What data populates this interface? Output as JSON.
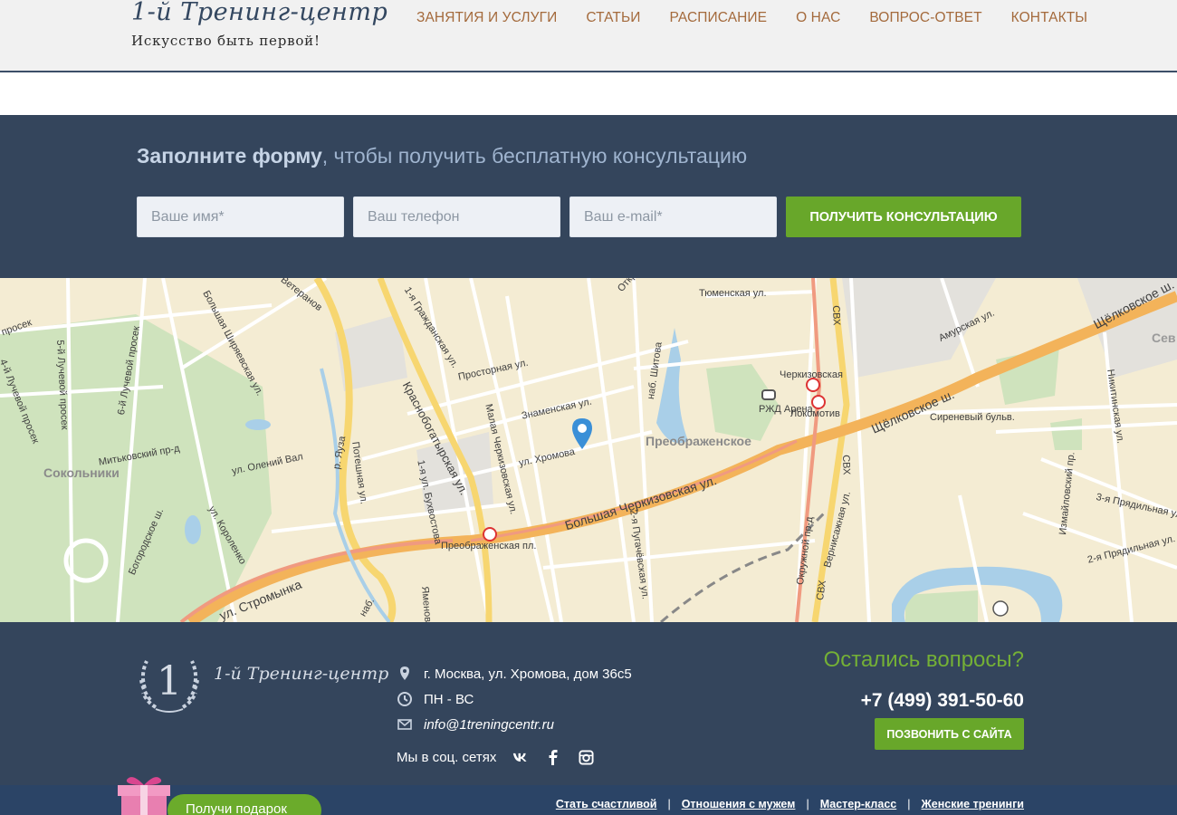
{
  "header": {
    "logo_title": "1-й Тренинг-центр",
    "logo_tagline": "Искусство быть первой!",
    "nav": [
      "ЗАНЯТИЯ И УСЛУГИ",
      "СТАТЬИ",
      "РАСПИСАНИЕ",
      "О НАС",
      "ВОПРОС-ОТВЕТ",
      "КОНТАКТЫ"
    ]
  },
  "form": {
    "heading_bold": "Заполните форму",
    "heading_rest": ", чтобы получить бесплатную консультацию",
    "name_placeholder": "Ваше имя*",
    "phone_placeholder": "Ваш телефон",
    "email_placeholder": "Ваш e-mail*",
    "submit_label": "ПОЛУЧИТЬ КОНСУЛЬТАЦИЮ",
    "accent_color": "#68a72a",
    "band_color": "#34455c"
  },
  "map": {
    "districts": [
      "Сокольники",
      "Преображенское",
      "Сев Изм"
    ],
    "streets": [
      "Тюменская ул.",
      "Амурская ул.",
      "Щёлковское ш.",
      "Черкизовская",
      "Локомотив",
      "РЖД Арена",
      "Сиреневый бульв.",
      "Просторная ул.",
      "Знаменская ул.",
      "ул. Хромова",
      "Большая Черкизовская ул.",
      "Преображенская пл.",
      "ул. Стромынка",
      "Краснобогатырская ул.",
      "Малая Черкизовская ул.",
      "наб. Шитова",
      "Окружной пр-д",
      "Вернисажная ул.",
      "Измайловский пр.",
      "3-я Прядильная ул.",
      "2-я Прядильная ул.",
      "Никитинская ул.",
      "2-я Пугачёвская ул.",
      "Потешная ул.",
      "1-я ул. Бухвостова",
      "ул. Олений Вал",
      "Богородское ш.",
      "ул. Короленко",
      "Митьковский пр-д",
      "6-й Лучевой просек",
      "5-й Лучевой просек",
      "4-й Лучевой просек",
      "Большая Ширяевская ул.",
      "1-я Гражданская ул.",
      "Ветеранов",
      "СВХ",
      "Открыт",
      "р. Яуза",
      "наб.",
      "просек",
      "Яменова"
    ]
  },
  "footer": {
    "brand": "1-й Тренинг-центр",
    "address": "г. Москва, ул. Хромова, дом 36с5",
    "hours": "ПН - ВС",
    "email": "info@1treningcentr.ru",
    "social_label": "Мы в соц. сетях",
    "questions": "Остались вопросы?",
    "phone": "+7 (499) 391-50-60",
    "callback_label": "ПОЗВОНИТЬ С САЙТА"
  },
  "bottom": {
    "gift_label": "Получи подарок",
    "links": [
      "Стать счастливой",
      "Отношения с мужем",
      "Мастер-класс",
      "Женские тренинги"
    ],
    "sep": "|"
  },
  "icons": {
    "pin": "location-pin-icon",
    "clock": "clock-icon",
    "mail": "mail-icon",
    "vk": "vk-icon",
    "facebook": "facebook-icon",
    "instagram": "instagram-icon",
    "metro": "metro-icon"
  }
}
